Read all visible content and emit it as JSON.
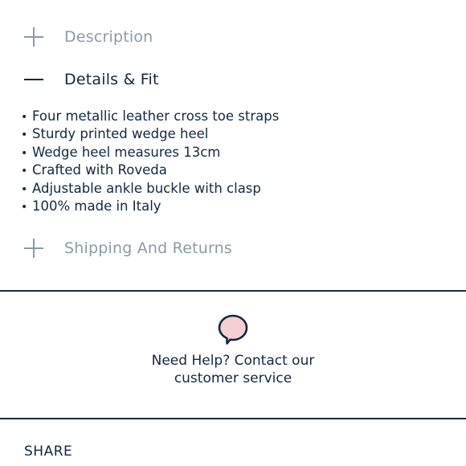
{
  "accordion": {
    "description": {
      "label": "Description",
      "state": "collapsed"
    },
    "details": {
      "label": "Details & Fit",
      "state": "expanded",
      "bullets": [
        "Four metallic leather cross toe straps",
        "Sturdy printed wedge heel",
        "Wedge heel measures 13cm",
        "Crafted with Roveda",
        "Adjustable ankle buckle with clasp",
        "100% made in Italy"
      ]
    },
    "shipping": {
      "label": "Shipping And Returns",
      "state": "collapsed"
    }
  },
  "help": {
    "icon": "speech-bubble-icon",
    "text": "Need Help? Contact our customer service"
  },
  "share": {
    "label": "SHARE"
  },
  "colors": {
    "navy": "#12283e",
    "muted": "#8a9aa8",
    "bubble_fill": "#f7cfd1",
    "divider": "#1b2b3c"
  }
}
